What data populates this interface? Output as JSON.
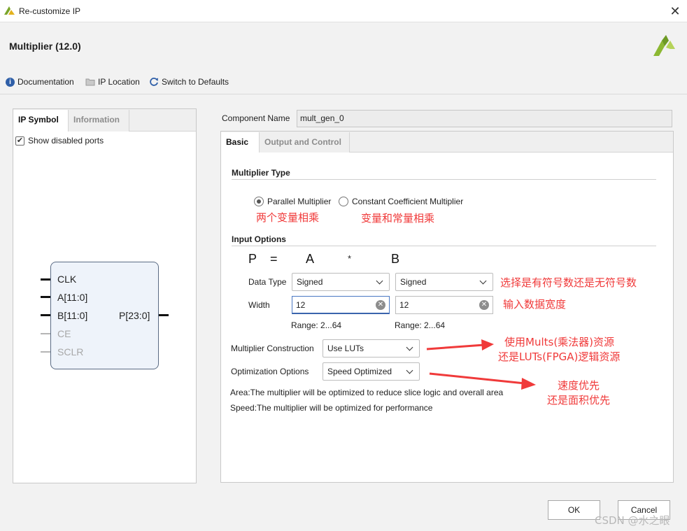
{
  "window": {
    "title": "Re-customize IP"
  },
  "header": {
    "title": "Multiplier (12.0)"
  },
  "toolbar": {
    "documentation": "Documentation",
    "ip_location": "IP Location",
    "switch_defaults": "Switch to Defaults"
  },
  "left_panel": {
    "tabs": [
      "IP Symbol",
      "Information"
    ],
    "show_disabled_ports": "Show disabled ports",
    "show_disabled_checked": true,
    "symbol": {
      "inputs": [
        "CLK",
        "A[11:0]",
        "B[11:0]",
        "CE",
        "SCLR"
      ],
      "output": "P[23:0]"
    }
  },
  "component": {
    "label": "Component Name",
    "value": "mult_gen_0"
  },
  "tabs": [
    "Basic",
    "Output and Control"
  ],
  "multiplier_type": {
    "title": "Multiplier Type",
    "options": [
      "Parallel Multiplier",
      "Constant Coefficient Multiplier"
    ],
    "selected": "Parallel Multiplier"
  },
  "input_options": {
    "title": "Input Options",
    "equation": {
      "p": "P",
      "eq": "=",
      "a": "A",
      "op": "*",
      "b": "B"
    },
    "data_type_label": "Data Type",
    "a_data_type": "Signed",
    "b_data_type": "Signed",
    "width_label": "Width",
    "a_width": "12",
    "b_width": "12",
    "a_range": "Range: 2...64",
    "b_range": "Range: 2...64"
  },
  "construction": {
    "label": "Multiplier Construction",
    "value": "Use LUTs"
  },
  "optimization": {
    "label": "Optimization Options",
    "value": "Speed Optimized"
  },
  "descriptions": {
    "area": "Area:The multiplier will be optimized to reduce slice logic and overall area",
    "speed": "Speed:The multiplier will be optimized for performance"
  },
  "annotations": {
    "parallel": "两个变量相乘",
    "constant": "变量和常量相乘",
    "signed": "选择是有符号数还是无符号数",
    "width": "输入数据宽度",
    "construction_1": "使用Mults(乘法器)资源",
    "construction_2": "还是LUTs(FPGA)逻辑资源",
    "optimization_1": "速度优先",
    "optimization_2": "还是面积优先"
  },
  "buttons": {
    "ok": "OK",
    "cancel": "Cancel"
  },
  "watermark": "CSDN @水之眼",
  "colors": {
    "annotation": "#f03a3a",
    "accent": "#4a78c2",
    "logo": "#8cb832"
  }
}
